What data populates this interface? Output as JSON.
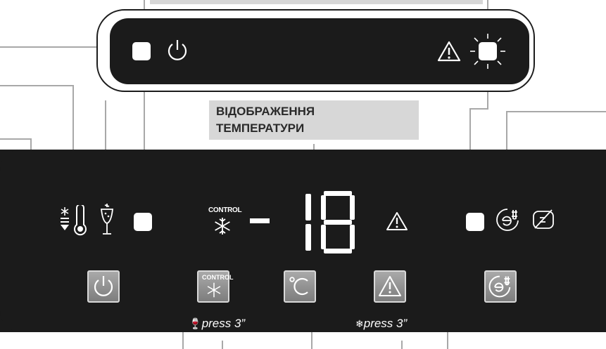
{
  "top_label": "…",
  "temperature_label_line1": "ВІДОБРАЖЕННЯ",
  "temperature_label_line2": "ТЕМПЕРАТУРИ",
  "display": {
    "sign": "-",
    "digits": "18"
  },
  "control_text": "CONTROL",
  "buttons": {
    "freeze_control_caption": "press 3”",
    "alarm_caption": "press 3”"
  },
  "icons": [
    "power-icon",
    "warning-icon",
    "fast-cool-icon",
    "bottle-chill-icon",
    "snowflake-icon",
    "celsius-icon",
    "eco-icon",
    "eco-off-icon"
  ],
  "colors": {
    "panel": "#1b1b1b",
    "button": "#8f8f8f",
    "label_bg": "#d7d7d7",
    "line": "#a8a8a8"
  }
}
